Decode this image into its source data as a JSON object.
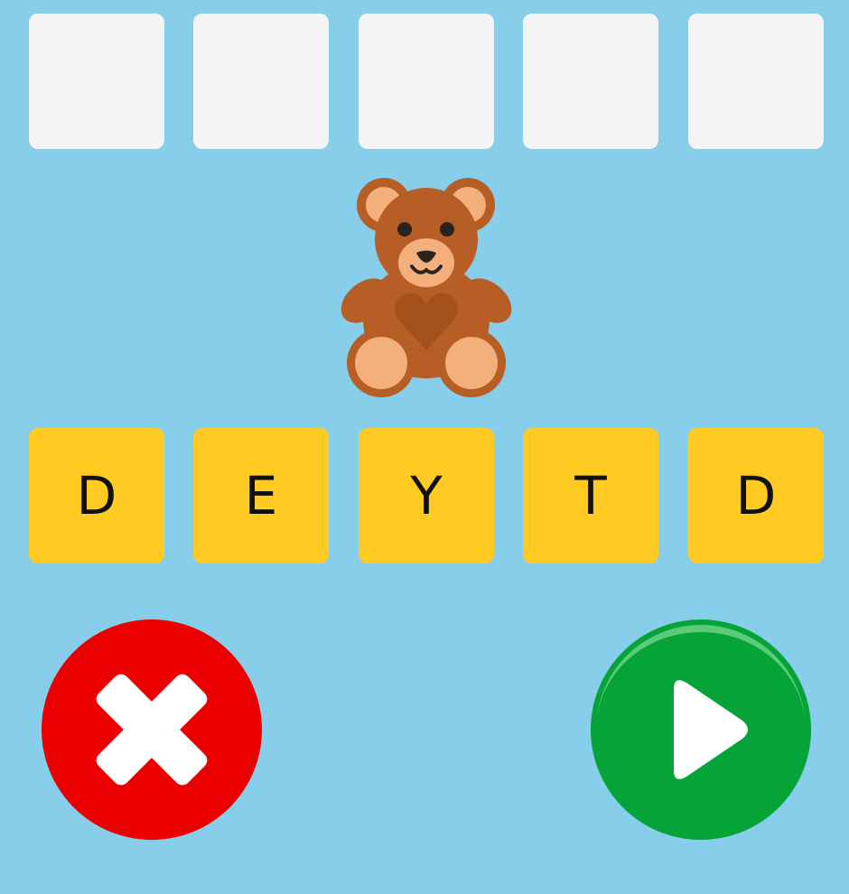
{
  "answer_slots": [
    "",
    "",
    "",
    "",
    ""
  ],
  "letter_tiles": [
    "D",
    "E",
    "Y",
    "T",
    "D"
  ],
  "picture": {
    "icon": "teddy-bear-icon"
  },
  "controls": {
    "cancel_icon": "close-icon",
    "play_icon": "play-icon"
  },
  "colors": {
    "background": "#87CEEA",
    "slot": "#F4F4F4",
    "tile": "#FFCB22",
    "cancel": "#EA0000",
    "play": "#06A338"
  }
}
